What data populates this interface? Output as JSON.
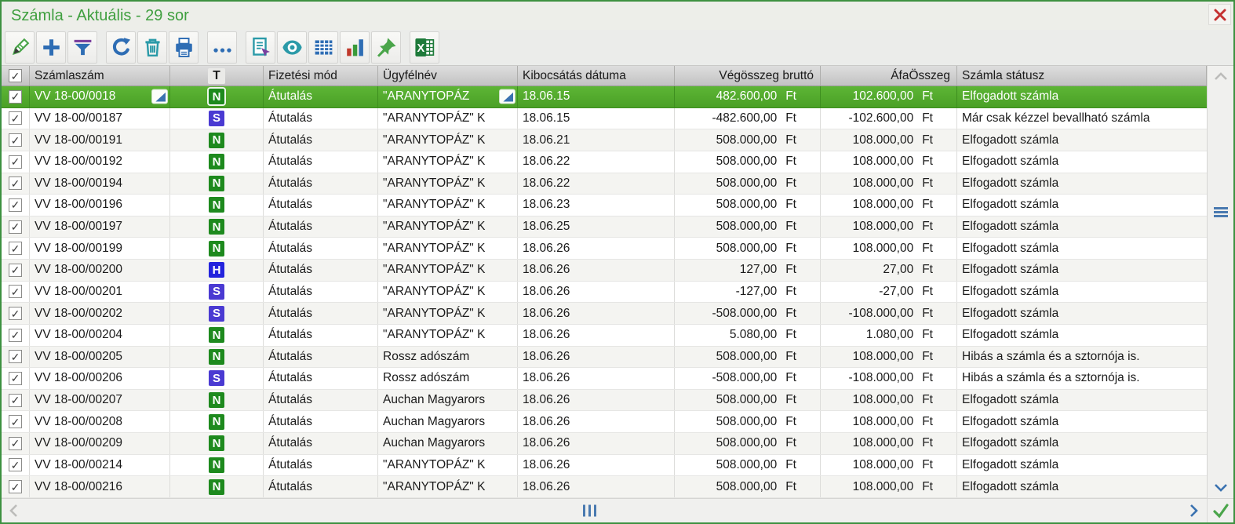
{
  "window": {
    "title": "Számla - Aktuális - 29 sor"
  },
  "colors": {
    "window_border_green": "#3d9140",
    "title_green": "#3f9f3f",
    "selected_row_green": "#52a92c",
    "toolbar_blue": "#2e6db4",
    "toolbar_teal": "#2b9aa8",
    "toolbar_purple": "#7a3f9e",
    "close_red": "#c43030",
    "scroll_grip_blue": "#4a7ab0",
    "badge_N": "#1e8a1e",
    "badge_S": "#4a3ad2",
    "badge_H": "#2424dd"
  },
  "toolbar": {
    "icons": [
      "edit-pencil",
      "add-plus",
      "filter-funnel",
      "refresh",
      "delete-trash",
      "print",
      "more-ellipsis",
      "report-select",
      "preview-eye",
      "table-grid",
      "bar-chart",
      "pin",
      "excel-export"
    ]
  },
  "table": {
    "currency": "Ft",
    "headers": {
      "invoice": "Számlaszám",
      "type": "T",
      "payment": "Fizetési mód",
      "customer": "Ügyfélnév",
      "date": "Kibocsátás dátuma",
      "gross": "Végösszeg bruttó",
      "vat": "ÁfaÖsszeg",
      "status": "Számla státusz"
    },
    "type_colors": {
      "N": "#1e8a1e",
      "S": "#4a3ad2",
      "H": "#2424dd"
    },
    "rows": [
      {
        "checked": true,
        "selected": true,
        "invoice": "VV 18-00/0018",
        "invoice_marker": true,
        "type": "N",
        "payment": "Átutalás",
        "customer": "\"ARANYTOPÁZ",
        "customer_marker": true,
        "date": "18.06.15",
        "gross": "482.600,00",
        "vat": "102.600,00",
        "status": "Elfogadott számla"
      },
      {
        "checked": true,
        "selected": false,
        "invoice": "VV 18-00/00187",
        "invoice_marker": false,
        "type": "S",
        "payment": "Átutalás",
        "customer": "\"ARANYTOPÁZ\" K",
        "customer_marker": false,
        "date": "18.06.15",
        "gross": "-482.600,00",
        "vat": "-102.600,00",
        "status": "Már csak kézzel bevallható számla"
      },
      {
        "checked": true,
        "selected": false,
        "invoice": "VV 18-00/00191",
        "invoice_marker": false,
        "type": "N",
        "payment": "Átutalás",
        "customer": "\"ARANYTOPÁZ\" K",
        "customer_marker": false,
        "date": "18.06.21",
        "gross": "508.000,00",
        "vat": "108.000,00",
        "status": "Elfogadott számla"
      },
      {
        "checked": true,
        "selected": false,
        "invoice": "VV 18-00/00192",
        "invoice_marker": false,
        "type": "N",
        "payment": "Átutalás",
        "customer": "\"ARANYTOPÁZ\" K",
        "customer_marker": false,
        "date": "18.06.22",
        "gross": "508.000,00",
        "vat": "108.000,00",
        "status": "Elfogadott számla"
      },
      {
        "checked": true,
        "selected": false,
        "invoice": "VV 18-00/00194",
        "invoice_marker": false,
        "type": "N",
        "payment": "Átutalás",
        "customer": "\"ARANYTOPÁZ\" K",
        "customer_marker": false,
        "date": "18.06.22",
        "gross": "508.000,00",
        "vat": "108.000,00",
        "status": "Elfogadott számla"
      },
      {
        "checked": true,
        "selected": false,
        "invoice": "VV 18-00/00196",
        "invoice_marker": false,
        "type": "N",
        "payment": "Átutalás",
        "customer": "\"ARANYTOPÁZ\" K",
        "customer_marker": false,
        "date": "18.06.23",
        "gross": "508.000,00",
        "vat": "108.000,00",
        "status": "Elfogadott számla"
      },
      {
        "checked": true,
        "selected": false,
        "invoice": "VV 18-00/00197",
        "invoice_marker": false,
        "type": "N",
        "payment": "Átutalás",
        "customer": "\"ARANYTOPÁZ\" K",
        "customer_marker": false,
        "date": "18.06.25",
        "gross": "508.000,00",
        "vat": "108.000,00",
        "status": "Elfogadott számla"
      },
      {
        "checked": true,
        "selected": false,
        "invoice": "VV 18-00/00199",
        "invoice_marker": false,
        "type": "N",
        "payment": "Átutalás",
        "customer": "\"ARANYTOPÁZ\" K",
        "customer_marker": false,
        "date": "18.06.26",
        "gross": "508.000,00",
        "vat": "108.000,00",
        "status": "Elfogadott számla"
      },
      {
        "checked": true,
        "selected": false,
        "invoice": "VV 18-00/00200",
        "invoice_marker": false,
        "type": "H",
        "payment": "Átutalás",
        "customer": "\"ARANYTOPÁZ\" K",
        "customer_marker": false,
        "date": "18.06.26",
        "gross": "127,00",
        "vat": "27,00",
        "status": "Elfogadott számla"
      },
      {
        "checked": true,
        "selected": false,
        "invoice": "VV 18-00/00201",
        "invoice_marker": false,
        "type": "S",
        "payment": "Átutalás",
        "customer": "\"ARANYTOPÁZ\" K",
        "customer_marker": false,
        "date": "18.06.26",
        "gross": "-127,00",
        "vat": "-27,00",
        "status": "Elfogadott számla"
      },
      {
        "checked": true,
        "selected": false,
        "invoice": "VV 18-00/00202",
        "invoice_marker": false,
        "type": "S",
        "payment": "Átutalás",
        "customer": "\"ARANYTOPÁZ\" K",
        "customer_marker": false,
        "date": "18.06.26",
        "gross": "-508.000,00",
        "vat": "-108.000,00",
        "status": "Elfogadott számla"
      },
      {
        "checked": true,
        "selected": false,
        "invoice": "VV 18-00/00204",
        "invoice_marker": false,
        "type": "N",
        "payment": "Átutalás",
        "customer": "\"ARANYTOPÁZ\" K",
        "customer_marker": false,
        "date": "18.06.26",
        "gross": "5.080,00",
        "vat": "1.080,00",
        "status": "Elfogadott számla"
      },
      {
        "checked": true,
        "selected": false,
        "invoice": "VV 18-00/00205",
        "invoice_marker": false,
        "type": "N",
        "payment": "Átutalás",
        "customer": "Rossz adószám",
        "customer_marker": false,
        "date": "18.06.26",
        "gross": "508.000,00",
        "vat": "108.000,00",
        "status": "Hibás a számla és a sztornója is."
      },
      {
        "checked": true,
        "selected": false,
        "invoice": "VV 18-00/00206",
        "invoice_marker": false,
        "type": "S",
        "payment": "Átutalás",
        "customer": "Rossz adószám",
        "customer_marker": false,
        "date": "18.06.26",
        "gross": "-508.000,00",
        "vat": "-108.000,00",
        "status": "Hibás a számla és a sztornója is."
      },
      {
        "checked": true,
        "selected": false,
        "invoice": "VV 18-00/00207",
        "invoice_marker": false,
        "type": "N",
        "payment": "Átutalás",
        "customer": "Auchan Magyarors",
        "customer_marker": false,
        "date": "18.06.26",
        "gross": "508.000,00",
        "vat": "108.000,00",
        "status": "Elfogadott számla"
      },
      {
        "checked": true,
        "selected": false,
        "invoice": "VV 18-00/00208",
        "invoice_marker": false,
        "type": "N",
        "payment": "Átutalás",
        "customer": "Auchan Magyarors",
        "customer_marker": false,
        "date": "18.06.26",
        "gross": "508.000,00",
        "vat": "108.000,00",
        "status": "Elfogadott számla"
      },
      {
        "checked": true,
        "selected": false,
        "invoice": "VV 18-00/00209",
        "invoice_marker": false,
        "type": "N",
        "payment": "Átutalás",
        "customer": "Auchan Magyarors",
        "customer_marker": false,
        "date": "18.06.26",
        "gross": "508.000,00",
        "vat": "108.000,00",
        "status": "Elfogadott számla"
      },
      {
        "checked": true,
        "selected": false,
        "invoice": "VV 18-00/00214",
        "invoice_marker": false,
        "type": "N",
        "payment": "Átutalás",
        "customer": "\"ARANYTOPÁZ\" K",
        "customer_marker": false,
        "date": "18.06.26",
        "gross": "508.000,00",
        "vat": "108.000,00",
        "status": "Elfogadott számla"
      },
      {
        "checked": true,
        "selected": false,
        "invoice": "VV 18-00/00216",
        "invoice_marker": false,
        "type": "N",
        "payment": "Átutalás",
        "customer": "\"ARANYTOPÁZ\" K",
        "customer_marker": false,
        "date": "18.06.26",
        "gross": "508.000,00",
        "vat": "108.000,00",
        "status": "Elfogadott számla"
      }
    ]
  }
}
